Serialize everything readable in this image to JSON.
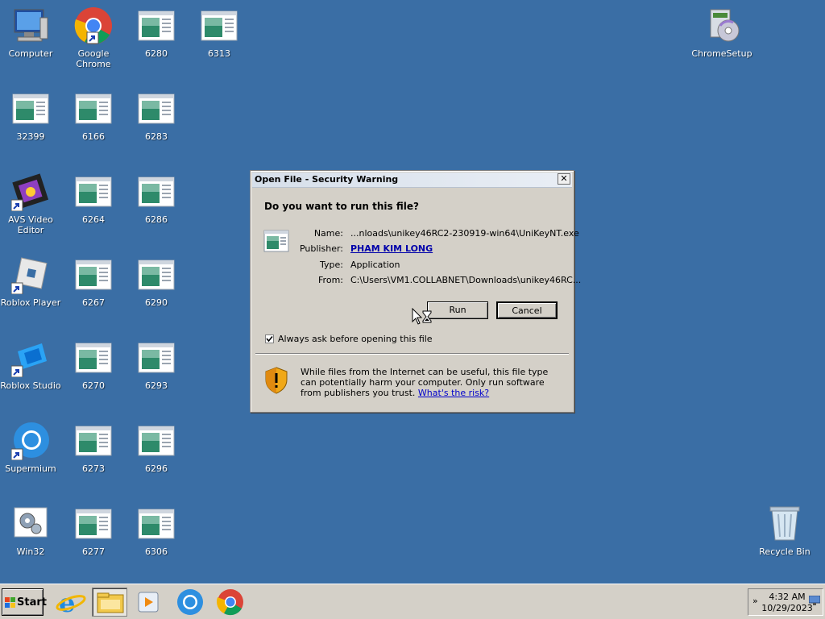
{
  "desktop": {
    "icons": [
      {
        "label": "Computer",
        "icon": "computer-icon"
      },
      {
        "label": "Google Chrome",
        "icon": "chrome-icon"
      },
      {
        "label": "6280",
        "icon": "window-file-icon"
      },
      {
        "label": "6313",
        "icon": "window-file-icon"
      },
      {
        "label": "ChromeSetup",
        "icon": "installer-icon"
      },
      {
        "label": "32399",
        "icon": "window-file-icon"
      },
      {
        "label": "6166",
        "icon": "window-file-icon"
      },
      {
        "label": "6283",
        "icon": "window-file-icon"
      },
      {
        "label": "AVS Video Editor",
        "icon": "film-icon"
      },
      {
        "label": "6264",
        "icon": "window-file-icon"
      },
      {
        "label": "6286",
        "icon": "window-file-icon"
      },
      {
        "label": "Roblox Player",
        "icon": "roblox-icon"
      },
      {
        "label": "6267",
        "icon": "window-file-icon"
      },
      {
        "label": "6290",
        "icon": "window-file-icon"
      },
      {
        "label": "Roblox Studio",
        "icon": "roblox-studio-icon"
      },
      {
        "label": "6270",
        "icon": "window-file-icon"
      },
      {
        "label": "6293",
        "icon": "window-file-icon"
      },
      {
        "label": "Supermium",
        "icon": "supermium-icon"
      },
      {
        "label": "6273",
        "icon": "window-file-icon"
      },
      {
        "label": "6296",
        "icon": "window-file-icon"
      },
      {
        "label": "Win32",
        "icon": "gear-icon"
      },
      {
        "label": "6277",
        "icon": "window-file-icon"
      },
      {
        "label": "6306",
        "icon": "window-file-icon"
      },
      {
        "label": "Recycle Bin",
        "icon": "recycle-bin-icon"
      }
    ]
  },
  "dialog": {
    "title": "Open File - Security Warning",
    "close_glyph": "✕",
    "question": "Do you want to run this file?",
    "fields": {
      "name_label": "Name:",
      "name_value": "...nloads\\unikey46RC2-230919-win64\\UniKeyNT.exe",
      "publisher_label": "Publisher:",
      "publisher_value": "PHAM KIM LONG",
      "type_label": "Type:",
      "type_value": "Application",
      "from_label": "From:",
      "from_value": "C:\\Users\\VM1.COLLABNET\\Downloads\\unikey46RC..."
    },
    "run_label": "Run",
    "cancel_label": "Cancel",
    "checkbox_label": "Always ask before opening this file",
    "checkbox_checked": true,
    "warning_text": "While files from the Internet can be useful, this file type can potentially harm your computer. Only run software from publishers you trust.",
    "risk_link": "What's the risk?"
  },
  "taskbar": {
    "start_label": "Start",
    "buttons": [
      "internet-explorer-icon",
      "file-explorer-icon",
      "media-player-icon",
      "supermium-icon",
      "chrome-icon"
    ],
    "tray_chevron": "»",
    "clock_time": "4:32 AM",
    "clock_date": "10/29/2023"
  },
  "colors": {
    "desktop_bg": "#3a6ea5",
    "dialog_bg": "#d4d0c8",
    "link": "#0000aa"
  }
}
